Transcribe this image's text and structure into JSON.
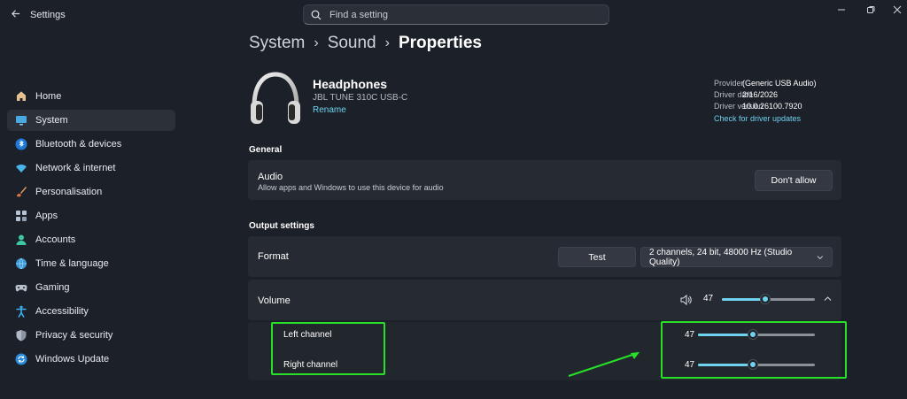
{
  "window": {
    "title": "Settings"
  },
  "search": {
    "placeholder": "Find a setting"
  },
  "sidebar": {
    "items": [
      {
        "label": "Home",
        "icon": "home-icon"
      },
      {
        "label": "System",
        "icon": "system-icon",
        "active": true
      },
      {
        "label": "Bluetooth & devices",
        "icon": "bluetooth-icon"
      },
      {
        "label": "Network & internet",
        "icon": "wifi-icon"
      },
      {
        "label": "Personalisation",
        "icon": "brush-icon"
      },
      {
        "label": "Apps",
        "icon": "apps-icon"
      },
      {
        "label": "Accounts",
        "icon": "person-icon"
      },
      {
        "label": "Time & language",
        "icon": "globe-icon"
      },
      {
        "label": "Gaming",
        "icon": "gamepad-icon"
      },
      {
        "label": "Accessibility",
        "icon": "accessibility-icon"
      },
      {
        "label": "Privacy & security",
        "icon": "shield-icon"
      },
      {
        "label": "Windows Update",
        "icon": "update-icon"
      }
    ]
  },
  "breadcrumb": {
    "items": [
      "System",
      "Sound"
    ],
    "current": "Properties"
  },
  "device": {
    "name": "Headphones",
    "model": "JBL TUNE 310C USB-C",
    "rename_label": "Rename"
  },
  "driver_info": {
    "provider_label": "Provider",
    "provider_value": "(Generic USB Audio)",
    "date_label": "Driver date",
    "date_value": "2/16/2026",
    "version_label": "Driver version",
    "version_value": "10.0.26100.7920",
    "update_link": "Check for driver updates"
  },
  "general": {
    "section_title": "General",
    "audio_title": "Audio",
    "audio_desc": "Allow apps and Windows to use this device for audio",
    "dont_allow_label": "Don't allow"
  },
  "output": {
    "section_title": "Output settings",
    "format_label": "Format",
    "test_label": "Test",
    "format_value": "2 channels, 24 bit, 48000 Hz (Studio Quality)",
    "volume_label": "Volume",
    "volume_value": "47",
    "volume_level": 0.47,
    "left_channel_label": "Left channel",
    "left_channel_value": "47",
    "left_channel_level": 0.47,
    "right_channel_label": "Right channel",
    "right_channel_value": "47",
    "right_channel_level": 0.47
  },
  "colors": {
    "accent": "#6fd3ef",
    "annotation": "#27e027",
    "background": "#1c2028",
    "card": "#262b33"
  }
}
